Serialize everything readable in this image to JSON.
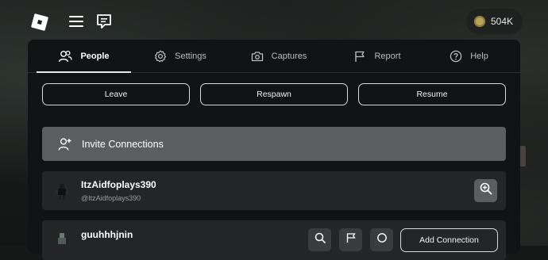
{
  "topbar": {
    "logo_icon": "roblox-logo-icon",
    "menu_icon": "hamburger-menu-icon",
    "chat_icon": "chat-icon",
    "robux_amount": "504K"
  },
  "tabs": [
    {
      "label": "People",
      "icon": "people-icon",
      "active": true
    },
    {
      "label": "Settings",
      "icon": "gear-icon",
      "active": false
    },
    {
      "label": "Captures",
      "icon": "camera-icon",
      "active": false
    },
    {
      "label": "Report",
      "icon": "flag-icon",
      "active": false
    },
    {
      "label": "Help",
      "icon": "help-icon",
      "active": false
    }
  ],
  "actions": {
    "leave": "Leave",
    "respawn": "Respawn",
    "resume": "Resume"
  },
  "invite": {
    "label": "Invite Connections",
    "icon": "add-person-icon"
  },
  "players": [
    {
      "display_name": "ItzAidfoplays390",
      "username": "@ItzAidfoplays390",
      "action_icon": "zoom-in-icon"
    },
    {
      "display_name": "guuhhhjnin",
      "username": "",
      "add_label": "Add Connection"
    }
  ],
  "colors": {
    "panel": "#111213",
    "invite_bg": "#5b5d60",
    "row_bg": "#232527",
    "active_tab": "#ffffff"
  }
}
